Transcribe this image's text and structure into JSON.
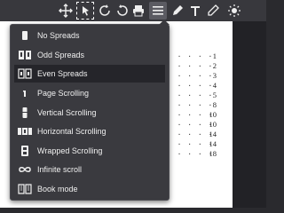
{
  "toolbar": {
    "buttons": [
      {
        "name": "move-icon"
      },
      {
        "name": "select-tool-icon"
      },
      {
        "name": "rotate-cw-icon"
      },
      {
        "name": "rotate-ccw-icon"
      },
      {
        "name": "print-icon"
      },
      {
        "name": "menu-icon"
      },
      {
        "name": "highlight-pen-icon"
      },
      {
        "name": "text-icon"
      },
      {
        "name": "draw-pencil-icon"
      },
      {
        "name": "brightness-icon"
      }
    ]
  },
  "spread_menu": {
    "items": [
      {
        "label": "No Spreads",
        "icon": "no-spreads-icon"
      },
      {
        "label": "Odd Spreads",
        "icon": "odd-spreads-icon"
      },
      {
        "label": "Even Spreads",
        "icon": "even-spreads-icon",
        "checked": true
      },
      {
        "label": "Page Scrolling",
        "icon": "page-scrolling-icon"
      },
      {
        "label": "Vertical Scrolling",
        "icon": "vertical-scrolling-icon"
      },
      {
        "label": "Horizontal Scrolling",
        "icon": "horizontal-scrolling-icon"
      },
      {
        "label": "Wrapped Scrolling",
        "icon": "wrapped-scrolling-icon"
      },
      {
        "label": "Infinite scroll",
        "icon": "infinite-scroll-icon"
      },
      {
        "label": "Book mode",
        "icon": "book-mode-icon"
      }
    ]
  },
  "toc_page_numbers": [
    "1",
    "2",
    "3",
    "4",
    "5",
    "8",
    "10",
    "10",
    "14",
    "14",
    "18"
  ]
}
